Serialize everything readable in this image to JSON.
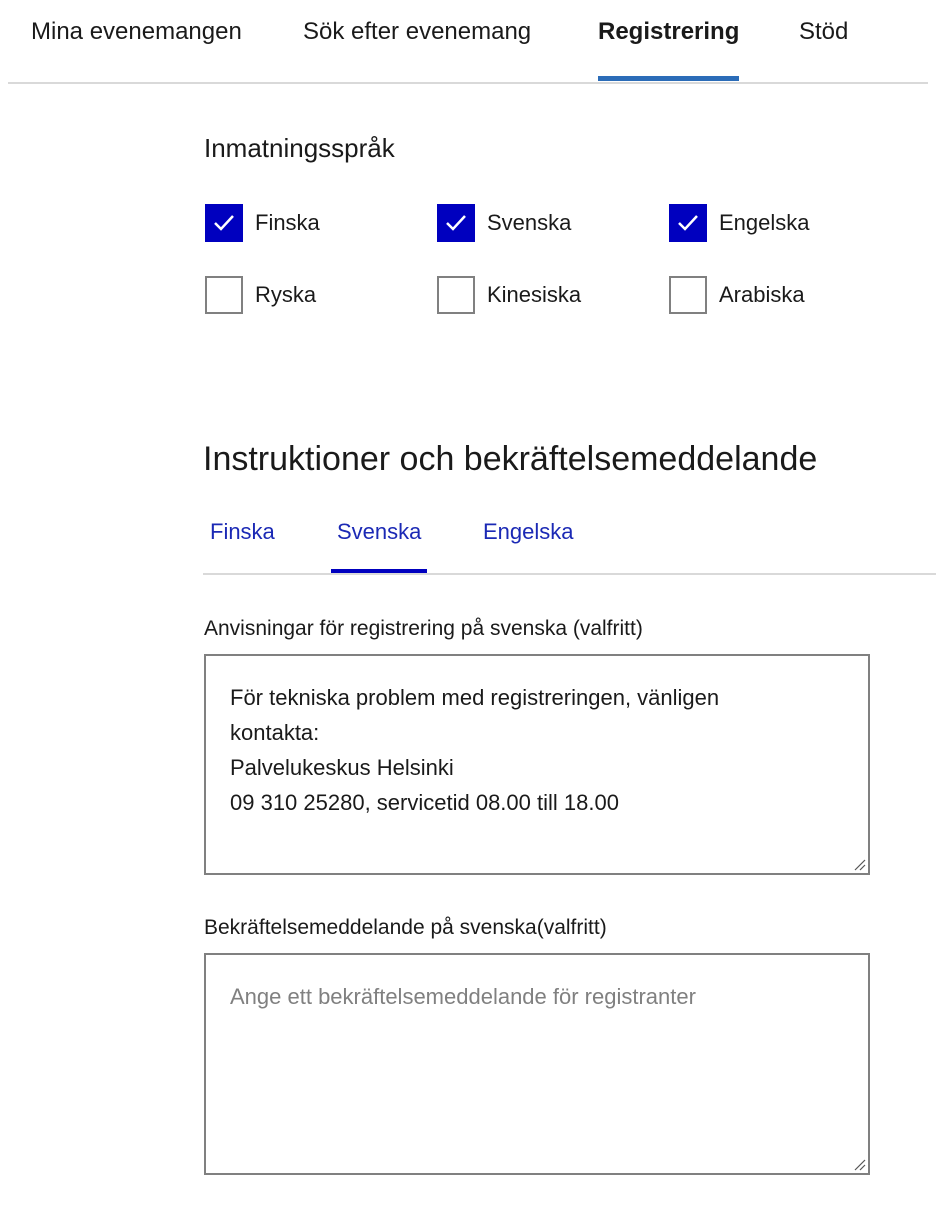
{
  "top_nav": {
    "tabs": [
      {
        "label": "Mina evenemangen",
        "active": false
      },
      {
        "label": "Sök efter evenemang",
        "active": false
      },
      {
        "label": "Registrering",
        "active": true
      },
      {
        "label": "Stöd",
        "active": false
      }
    ],
    "accent_color": "#2b6cb8"
  },
  "input_languages": {
    "title": "Inmatningsspråk",
    "options": [
      {
        "label": "Finska",
        "checked": true
      },
      {
        "label": "Svenska",
        "checked": true
      },
      {
        "label": "Engelska",
        "checked": true
      },
      {
        "label": "Ryska",
        "checked": false
      },
      {
        "label": "Kinesiska",
        "checked": false
      },
      {
        "label": "Arabiska",
        "checked": false
      }
    ],
    "checked_color": "#0000bf"
  },
  "instructions": {
    "heading": "Instruktioner och bekräftelsemeddelande",
    "tabs": [
      {
        "label": "Finska",
        "active": false
      },
      {
        "label": "Svenska",
        "active": true
      },
      {
        "label": "Engelska",
        "active": false
      }
    ],
    "registration_field": {
      "label": "Anvisningar för registrering på svenska (valfritt)",
      "value_lines": [
        "För tekniska problem med registreringen, vänligen",
        "kontakta:",
        "Palvelukeskus Helsinki",
        "09 310 25280, servicetid 08.00 till 18.00"
      ]
    },
    "confirmation_field": {
      "label": "Bekräftelsemeddelande på svenska(valfritt)",
      "value": "",
      "placeholder": "Ange ett bekräftelsemeddelande för registranter"
    }
  }
}
